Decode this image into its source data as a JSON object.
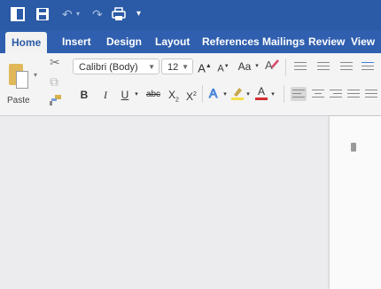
{
  "quick_access": {
    "icons": [
      "sidebar-icon",
      "save-icon",
      "undo-icon",
      "redo-icon",
      "print-icon",
      "customize-icon"
    ]
  },
  "tabs": [
    "Home",
    "Insert",
    "Design",
    "Layout",
    "References",
    "Mailings",
    "Review",
    "View"
  ],
  "active_tab": "Home",
  "clipboard": {
    "paste_label": "Paste"
  },
  "font": {
    "family": "Calibri (Body)",
    "size": "12",
    "grow_label": "A",
    "shrink_label": "A",
    "bold_label": "B",
    "italic_label": "I",
    "underline_label": "U",
    "strike_label": "abc",
    "subscript_label": "X",
    "subscript_sub": "2",
    "superscript_label": "X",
    "superscript_sup": "2",
    "change_case_label": "Aa",
    "font_color_label": "A"
  },
  "colors": {
    "titlebar": "#2b5aa6",
    "tabs": "#2f5fae",
    "highlight": "#f4e04a",
    "font_color": "#d32f2f",
    "text_effects": "#3f7fd8"
  }
}
